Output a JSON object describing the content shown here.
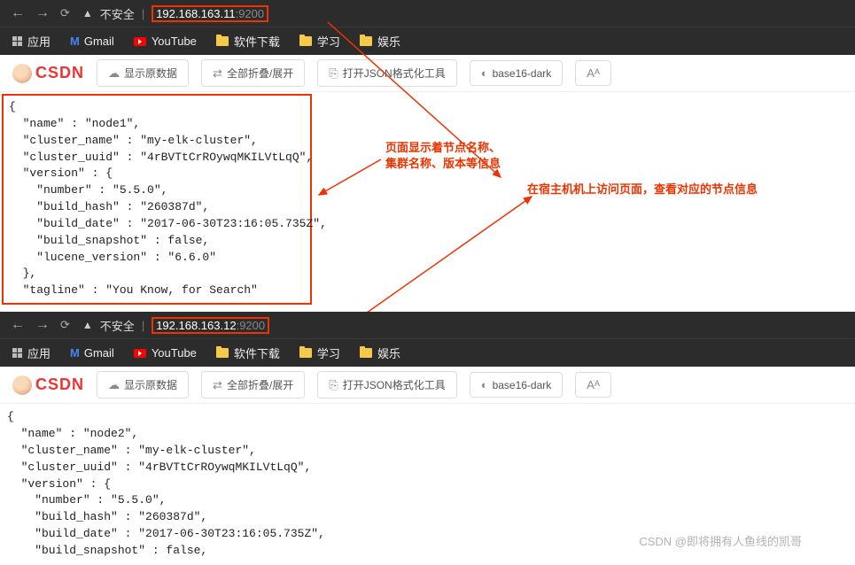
{
  "browser1": {
    "insecure_label": "不安全",
    "url_host": "192.168.163.11",
    "url_port": ":9200"
  },
  "browser2": {
    "insecure_label": "不安全",
    "url_host": "192.168.163.12",
    "url_port": ":9200"
  },
  "bookmarks": {
    "apps": "应用",
    "gmail": "Gmail",
    "youtube": "YouTube",
    "download": "软件下载",
    "study": "学习",
    "entertain": "娱乐"
  },
  "toolbar": {
    "show_raw": "显示原数据",
    "collapse_expand": "全部折叠/展开",
    "open_json_tool": "打开JSON格式化工具",
    "theme": "base16-dark"
  },
  "csdn_brand": "CSDN",
  "json1": {
    "raw": "{\n  \"name\" : \"node1\",\n  \"cluster_name\" : \"my-elk-cluster\",\n  \"cluster_uuid\" : \"4rBVTtCrROywqMKILVtLqQ\",\n  \"version\" : {\n    \"number\" : \"5.5.0\",\n    \"build_hash\" : \"260387d\",\n    \"build_date\" : \"2017-06-30T23:16:05.735Z\",\n    \"build_snapshot\" : false,\n    \"lucene_version\" : \"6.6.0\"\n  },\n  \"tagline\" : \"You Know, for Search\""
  },
  "json2": {
    "raw": "{\n  \"name\" : \"node2\",\n  \"cluster_name\" : \"my-elk-cluster\",\n  \"cluster_uuid\" : \"4rBVTtCrROywqMKILVtLqQ\",\n  \"version\" : {\n    \"number\" : \"5.5.0\",\n    \"build_hash\" : \"260387d\",\n    \"build_date\" : \"2017-06-30T23:16:05.735Z\",\n    \"build_snapshot\" : false,"
  },
  "annotations": {
    "a1_l1": "页面显示着节点名称、",
    "a1_l2": "集群名称、版本等信息",
    "a2": "在宿主机机上访问页面，查看对应的节点信息"
  },
  "watermark": "CSDN @即将拥有人鱼线的凯哥"
}
